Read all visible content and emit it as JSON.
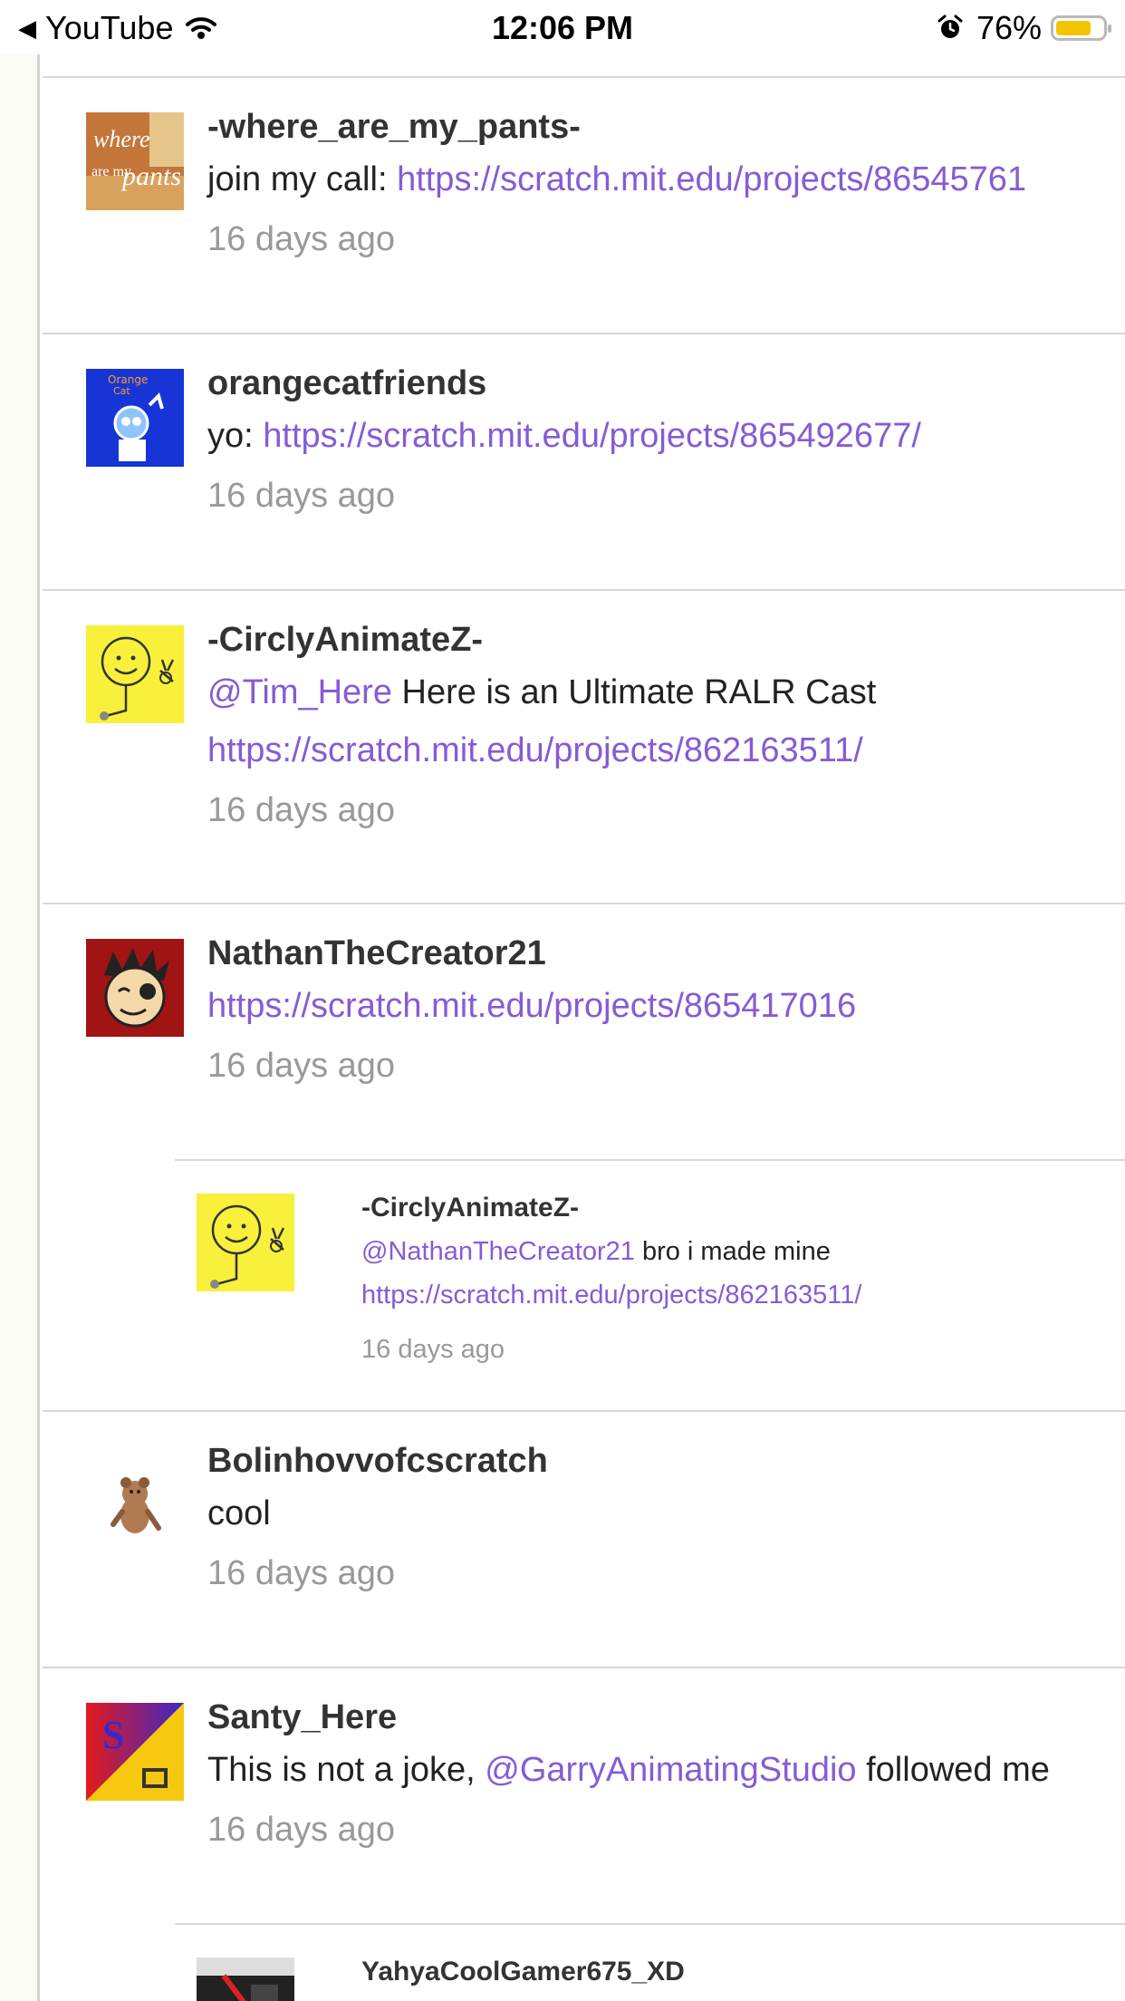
{
  "status_bar": {
    "back_app": "YouTube",
    "time": "12:06 PM",
    "battery": "76%",
    "battery_level": 0.76,
    "icons": [
      "back-arrow-icon",
      "wifi-icon",
      "alarm-icon",
      "battery-icon"
    ]
  },
  "colors": {
    "link": "#855cd6",
    "time": "#999999",
    "username": "#333333"
  },
  "comments": [
    {
      "username": "-where_are_my_pants-",
      "line1_prefix": "join my call: ",
      "line1_link": "https://scratch.mit.edu/projects/86545761",
      "time": "16 days ago",
      "avatar_text": "where are my pants?"
    },
    {
      "username": "orangecatfriends",
      "line1_prefix": "yo: ",
      "line1_link": "https://scratch.mit.edu/projects/865492677/",
      "time": "16 days ago",
      "avatar_text": "Orange Cat Friends"
    },
    {
      "username": "-CirclyAnimateZ-",
      "line1_mention": "@Tim_Here",
      "line1_text": " Here is an Ultimate RALR Cast",
      "line2_link": "https://scratch.mit.edu/projects/862163511/",
      "time": "16 days ago"
    },
    {
      "username": "NathanTheCreator21",
      "line1_link": "https://scratch.mit.edu/projects/865417016",
      "time": "16 days ago"
    },
    {
      "username": "-CirclyAnimateZ-",
      "line1_mention": "@NathanTheCreator21",
      "line1_text": " bro i made mine",
      "line2_link": "https://scratch.mit.edu/projects/862163511/",
      "time": "16 days ago"
    },
    {
      "username": "Bolinhovvofcscratch",
      "line1_text": "cool",
      "time": "16 days ago"
    },
    {
      "username": "Santy_Here",
      "line1_text": "This is not a joke, ",
      "line1_mention": "@GarryAnimatingStudio",
      "line1_suffix": " followed me",
      "time": "16 days ago"
    },
    {
      "username": "YahyaCoolGamer675_XD"
    }
  ]
}
